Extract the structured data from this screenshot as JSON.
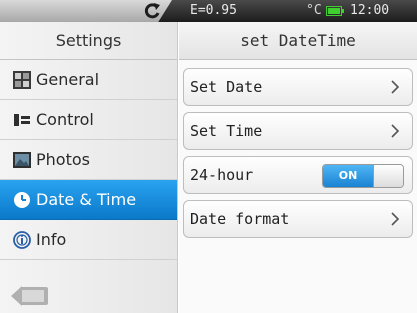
{
  "status": {
    "emissivity": "E=0.95",
    "unit": "°C",
    "time": "12:00",
    "battery_color": "#3fcf2f"
  },
  "sidebar": {
    "title": "Settings",
    "items": [
      {
        "label": "General",
        "icon": "general-icon"
      },
      {
        "label": "Control",
        "icon": "control-icon"
      },
      {
        "label": "Photos",
        "icon": "photos-icon"
      },
      {
        "label": "Date & Time",
        "icon": "clock-icon",
        "active": true
      },
      {
        "label": "Info",
        "icon": "info-icon"
      }
    ]
  },
  "main": {
    "title": "set DateTime",
    "rows": [
      {
        "label": "Set Date"
      },
      {
        "label": "Set Time"
      },
      {
        "label": "24-hour",
        "toggle": "ON"
      },
      {
        "label": "Date format"
      }
    ]
  },
  "colors": {
    "accent": "#1a8ee0",
    "statusbar": "#2a2a2a"
  }
}
